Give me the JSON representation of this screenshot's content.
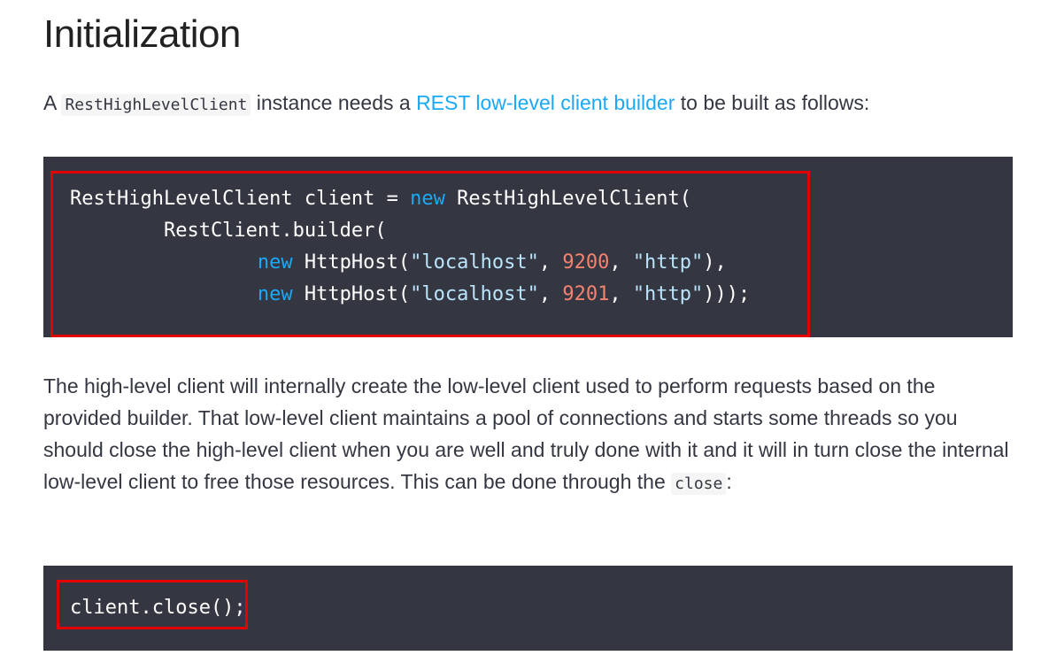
{
  "heading": "Initialization",
  "intro": {
    "prefix": "A",
    "code": "RestHighLevelClient",
    "middle": "instance needs a",
    "link_text": "REST low-level client builder",
    "suffix": "to be built as follows:"
  },
  "code_block_1": {
    "line1": {
      "a": "RestHighLevelClient client = ",
      "kw": "new",
      "b": " RestHighLevelClient("
    },
    "line2": {
      "a": "        RestClient.builder("
    },
    "line3": {
      "indent": "                ",
      "kw": "new",
      "a": " HttpHost(",
      "s1": "\"localhost\"",
      "c1": ", ",
      "n": "9200",
      "c2": ", ",
      "s2": "\"http\"",
      "end": "),"
    },
    "line4": {
      "indent": "                ",
      "kw": "new",
      "a": " HttpHost(",
      "s1": "\"localhost\"",
      "c1": ", ",
      "n": "9201",
      "c2": ", ",
      "s2": "\"http\"",
      "end": ")));"
    }
  },
  "paragraph": {
    "text": "The high-level client will internally create the low-level client used to perform requests based on the provided builder. That low-level client maintains a pool of connections and starts some threads so you should close the high-level client when you are well and truly done with it and it will in turn close the internal low-level client to free those resources. This can be done through the",
    "code": "close",
    "suffix": ":"
  },
  "code_block_2": {
    "line1": "client.close();"
  },
  "colors": {
    "code_bg": "#343741",
    "keyword": "#1ba9f5",
    "string": "#b9e4fc",
    "number": "#f38370",
    "highlight_border": "#e30000",
    "link": "#1ba9f5"
  }
}
